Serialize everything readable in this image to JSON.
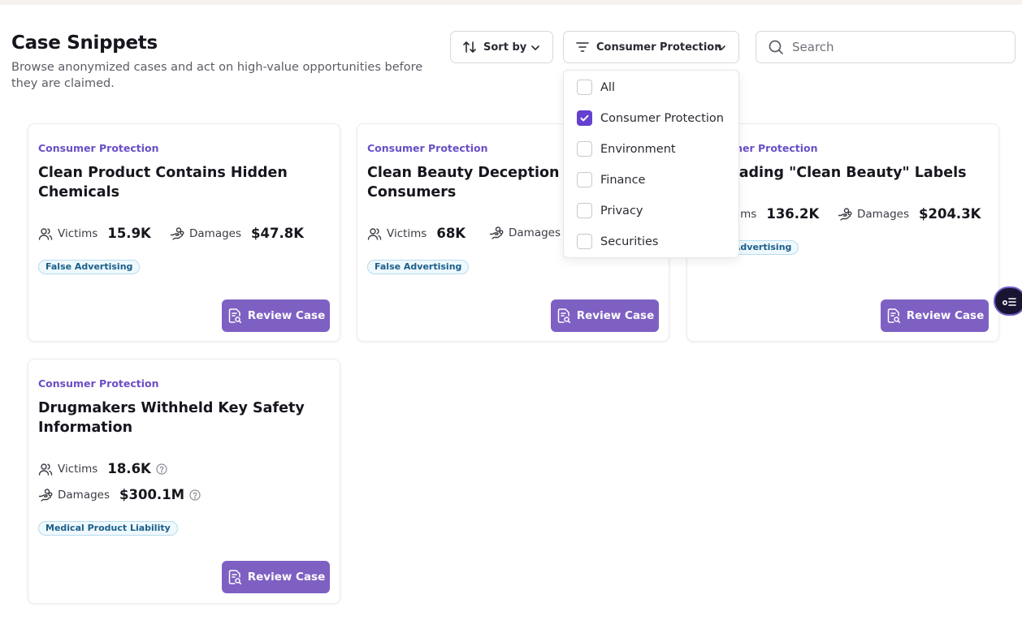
{
  "header": {
    "title": "Case Snippets",
    "subtitle": "Browse anonymized cases and act on high-value opportunities before they are claimed."
  },
  "toolbar": {
    "sort_label": "Sort by",
    "filter_label": "Consumer Protection",
    "search_placeholder": "Search"
  },
  "filter_options": [
    {
      "label": "All",
      "checked": false
    },
    {
      "label": "Consumer Protection",
      "checked": true
    },
    {
      "label": "Environment",
      "checked": false
    },
    {
      "label": "Finance",
      "checked": false
    },
    {
      "label": "Privacy",
      "checked": false
    },
    {
      "label": "Securities",
      "checked": false
    }
  ],
  "labels": {
    "victims": "Victims",
    "damages": "Damages",
    "review": "Review Case"
  },
  "cards": [
    {
      "category": "Consumer Protection",
      "title": "Clean Product Contains Hidden Chemicals",
      "victims": "15.9K",
      "damages": "$47.8K",
      "tag": "False Advertising"
    },
    {
      "category": "Consumer Protection",
      "title": "Clean Beauty Deception Harms Consumers",
      "victims": "68K",
      "damages": "",
      "tag": "False Advertising"
    },
    {
      "category": "Consumer Protection",
      "title": "Misleading \"Clean Beauty\" Labels",
      "victims": "136.2K",
      "damages": "$204.3K",
      "tag": "False Advertising"
    },
    {
      "category": "Consumer Protection",
      "title": "Drugmakers Withheld Key Safety Information",
      "victims": "18.6K",
      "damages": "$300.1M",
      "tag": "Medical Product Liability"
    }
  ],
  "colors": {
    "accent": "#7e60c3",
    "checkbox": "#6340d0",
    "category": "#6b4fc6",
    "tag_text": "#1b5f8a"
  }
}
